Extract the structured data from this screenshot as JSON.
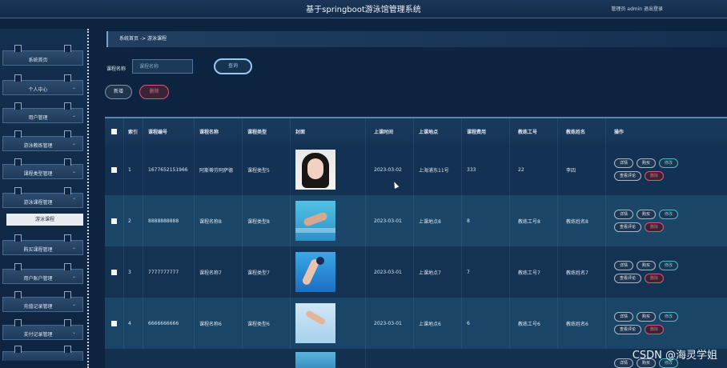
{
  "app": {
    "title": "基于springboot游泳馆管理系统",
    "user_text": "管理员 admin   退出登录"
  },
  "sidebar": {
    "items": [
      {
        "label": "系统首页"
      },
      {
        "label": "个人中心"
      },
      {
        "label": "用户管理"
      },
      {
        "label": "游泳教练管理"
      },
      {
        "label": "课程类型管理"
      },
      {
        "label": "游泳课程管理"
      },
      {
        "label": "购买课程管理"
      },
      {
        "label": "用户账户管理"
      },
      {
        "label": "充值记录管理"
      },
      {
        "label": "支付记录管理"
      }
    ],
    "sub_item": "游泳课程",
    "chevron": "⌄",
    "chevron_up": "⌃"
  },
  "breadcrumb": "系统首页  ->  游泳课程",
  "search": {
    "label": "课程名称",
    "placeholder": "课程名称",
    "query_button": "查询"
  },
  "actions": {
    "add": "新增",
    "delete": "删除"
  },
  "table": {
    "headers": {
      "index": "索引",
      "course_no": "课程编号",
      "course_name": "课程名称",
      "course_type": "课程类型",
      "cover": "封面",
      "time": "上课时间",
      "location": "上课地点",
      "fee": "课程费用",
      "coach_no": "教练工号",
      "coach_name": "教练姓名",
      "ops": "操作"
    },
    "rows": [
      {
        "index": "1",
        "course_no": "1677652151966",
        "course_name": "阿斯蒂芬阿萨德",
        "course_type": "课程类型5",
        "time": "2023-03-02",
        "location": "上海浦东11号",
        "fee": "333",
        "coach_no": "22",
        "coach_name": "李四",
        "cover_icon": "portrait-photo"
      },
      {
        "index": "2",
        "course_no": "8888888888",
        "course_name": "课程名称8",
        "course_type": "课程类型8",
        "time": "2023-03-01",
        "location": "上课地点8",
        "fee": "8",
        "coach_no": "教练工号8",
        "coach_name": "教练姓名8",
        "cover_icon": "pool-photo"
      },
      {
        "index": "3",
        "course_no": "7777777777",
        "course_name": "课程名称7",
        "course_type": "课程类型7",
        "time": "2023-03-01",
        "location": "上课地点7",
        "fee": "7",
        "coach_no": "教练工号7",
        "coach_name": "教练姓名7",
        "cover_icon": "dive-photo"
      },
      {
        "index": "4",
        "course_no": "6666666666",
        "course_name": "课程名称6",
        "course_type": "课程类型6",
        "time": "2023-03-01",
        "location": "上课地点6",
        "fee": "6",
        "coach_no": "教练工号6",
        "coach_name": "教练姓名6",
        "cover_icon": "swim-photo"
      }
    ],
    "row_actions": {
      "detail": "详情",
      "buy": "购买",
      "edit": "修改",
      "reviews": "查看评论",
      "delete": "删除"
    },
    "partial_row_actions": {
      "detail": "详情",
      "buy": "购买",
      "edit": "修改"
    }
  },
  "watermark": "CSDN @海灵学姐",
  "colors": {
    "background": "#0d2440",
    "accent": "#9ac7f0",
    "danger": "#e06b86",
    "edit": "#6fd0de"
  }
}
